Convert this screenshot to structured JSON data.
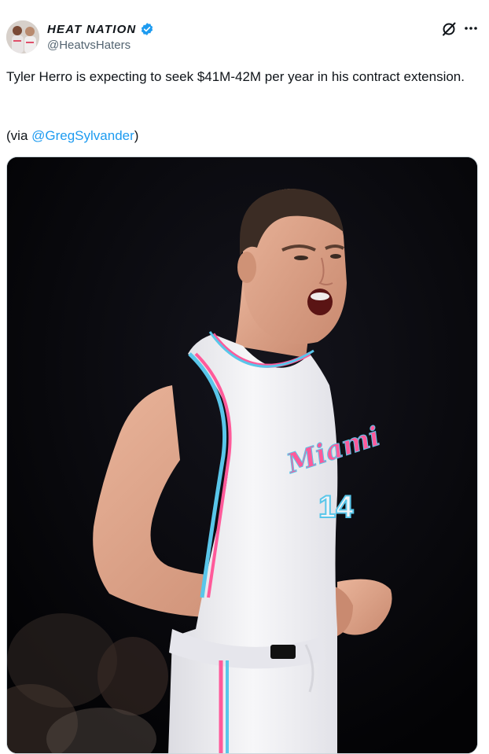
{
  "author": {
    "display_name": "HEAT NATION",
    "handle": "@HeatvsHaters",
    "verified": true
  },
  "tweet": {
    "text": "Tyler Herro is expecting to seek $41M-42M per year in his contract extension.",
    "via_prefix": "(via ",
    "via_mention": "@GregSylvander",
    "via_suffix": ")"
  },
  "media": {
    "jersey_wordmark": "Miami",
    "jersey_number": "14",
    "colors": {
      "background": "#050508",
      "jersey": "#f4f4f6",
      "pink": "#ff5a9a",
      "blue": "#59c6ea"
    }
  },
  "icons": {
    "verified": "verified-badge-icon",
    "grok": "grok-icon",
    "more": "more-options-icon"
  },
  "accent": "#1d9bf0"
}
